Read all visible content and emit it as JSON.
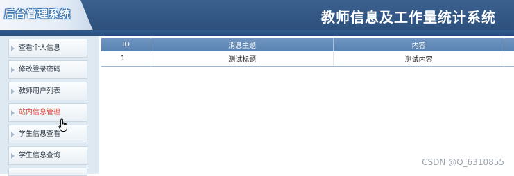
{
  "header": {
    "logo_text": "后台管理系统",
    "system_title": "教师信息及工作量统计系统"
  },
  "sidebar": {
    "items": [
      {
        "label": "查看个人信息"
      },
      {
        "label": "修改登录密码"
      },
      {
        "label": "教师用户列表"
      },
      {
        "label": "站内信息管理"
      },
      {
        "label": "学生信息查看"
      },
      {
        "label": "学生信息查询"
      }
    ],
    "active_color": "#e0463a"
  },
  "table": {
    "headers": [
      "ID",
      "消息主题",
      "内容"
    ],
    "rows": [
      {
        "id": "1",
        "subject": "测试标题",
        "content": "测试内容"
      }
    ]
  },
  "watermark": "CSDN @Q_6310855"
}
